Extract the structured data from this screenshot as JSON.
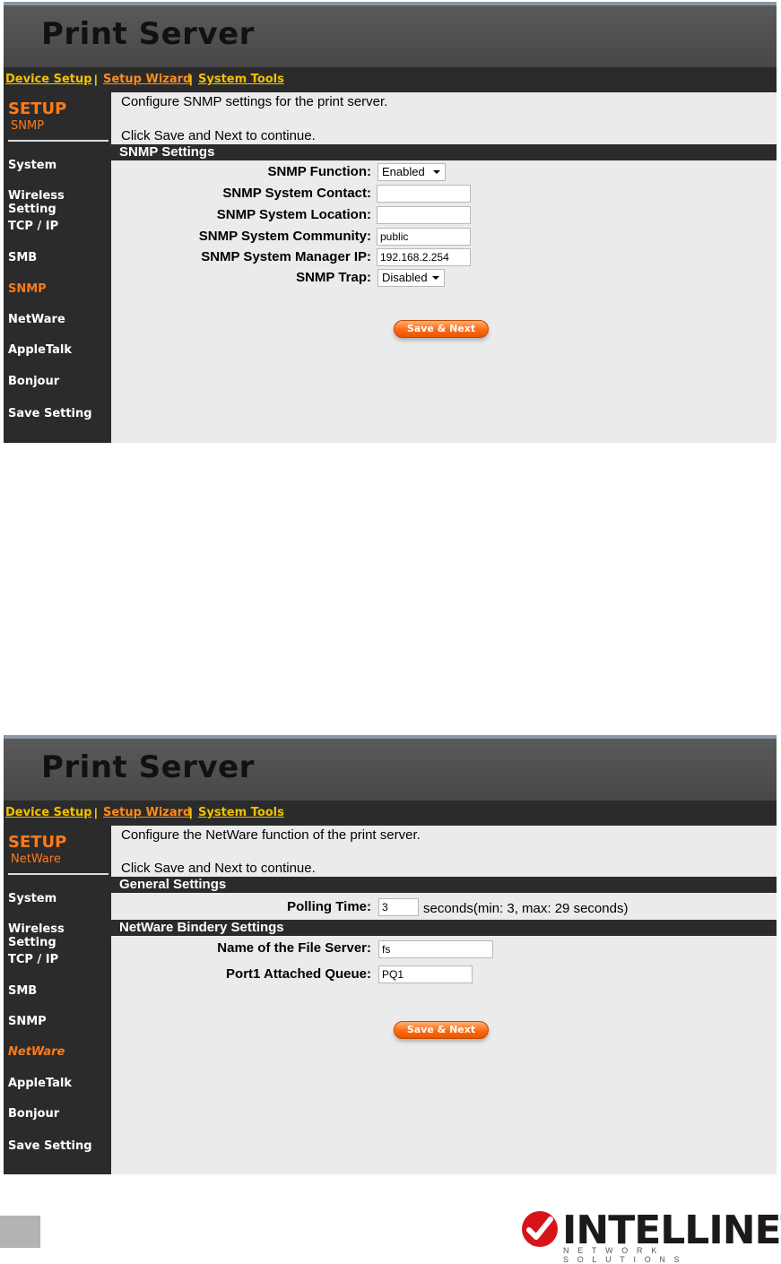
{
  "screens": [
    {
      "app_title": "Print Server",
      "menu": {
        "device_setup": "Device Setup",
        "sep1": "|",
        "setup_wizard": "Setup Wizard",
        "sep2": "|",
        "system_tools": "System Tools"
      },
      "sidebar": {
        "heading": "SETUP",
        "subheading": "SNMP",
        "items": [
          "System",
          "Wireless Setting",
          "TCP / IP",
          "SMB",
          "SNMP",
          "NetWare",
          "AppleTalk",
          "Bonjour",
          "Save Setting"
        ],
        "active": "SNMP"
      },
      "intro_line1": "Configure SNMP settings for the print server.",
      "intro_line2": "Click Save and Next to continue.",
      "section_title": "SNMP Settings",
      "fields": {
        "function_label": "SNMP Function:",
        "function_value": "Enabled",
        "contact_label": "SNMP System Contact:",
        "contact_value": "",
        "location_label": "SNMP System Location:",
        "location_value": "",
        "community_label": "SNMP System Community:",
        "community_value": "public",
        "manager_label": "SNMP System Manager IP:",
        "manager_value": "192.168.2.254",
        "trap_label": "SNMP Trap:",
        "trap_value": "Disabled"
      },
      "save_button": "Save & Next"
    },
    {
      "app_title": "Print Server",
      "menu": {
        "device_setup": "Device Setup",
        "sep1": "|",
        "setup_wizard": "Setup Wizard",
        "sep2": "|",
        "system_tools": "System Tools"
      },
      "sidebar": {
        "heading": "SETUP",
        "subheading": "NetWare",
        "items": [
          "System",
          "Wireless Setting",
          "TCP / IP",
          "SMB",
          "SNMP",
          "NetWare",
          "AppleTalk",
          "Bonjour",
          "Save Setting"
        ],
        "active": "NetWare"
      },
      "intro_line1": "Configure the NetWare function of the print server.",
      "intro_line2": "Click Save and Next to continue.",
      "general_title": "General Settings",
      "polling_label": "Polling Time:",
      "polling_value": "3",
      "polling_suffix": "seconds(min: 3, max: 29 seconds)",
      "bindery_title": "NetWare Bindery Settings",
      "file_server_label": "Name of the File Server:",
      "file_server_value": "fs",
      "queue_label": "Port1 Attached Queue:",
      "queue_value": "PQ1",
      "save_button": "Save & Next"
    }
  ],
  "footer": {
    "brand": "INTELLINET",
    "tagline": "NETWORK SOLUTIONS"
  },
  "colors": {
    "accent_orange": "#ff7a1a",
    "menu_yellow": "#f2c100",
    "dark_bg": "#2b2b2b",
    "content_bg": "#ebebeb",
    "logo_red": "#d7141a"
  }
}
